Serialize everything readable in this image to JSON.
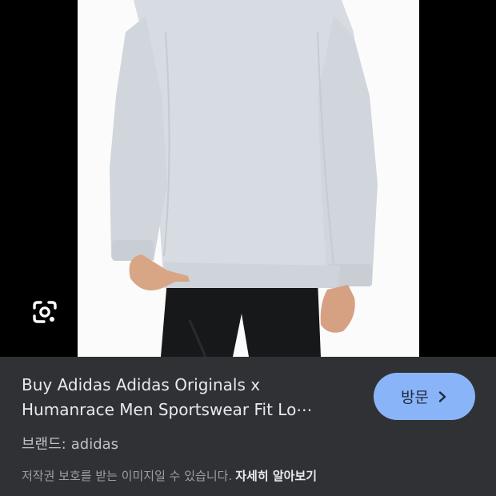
{
  "image": {
    "alt": "grey adidas sweatshirt product photo",
    "lens_icon": "lens-camera-icon"
  },
  "info": {
    "title": "Buy Adidas Adidas Originals x Humanrace Men Sportswear Fit Lo⋯",
    "visit_label": "방문",
    "visit_icon": "chevron-right-icon",
    "brand_label": "브랜드:",
    "brand_value": "adidas",
    "copyright_text": "저작권 보호를 받는 이미지일 수 있습니다.",
    "learn_more_label": "자세히 알아보기"
  },
  "colors": {
    "panel_bg": "#303134",
    "accent_button": "#8ab4f8",
    "sweatshirt": "#d7dbe2",
    "pants": "#17181a"
  }
}
